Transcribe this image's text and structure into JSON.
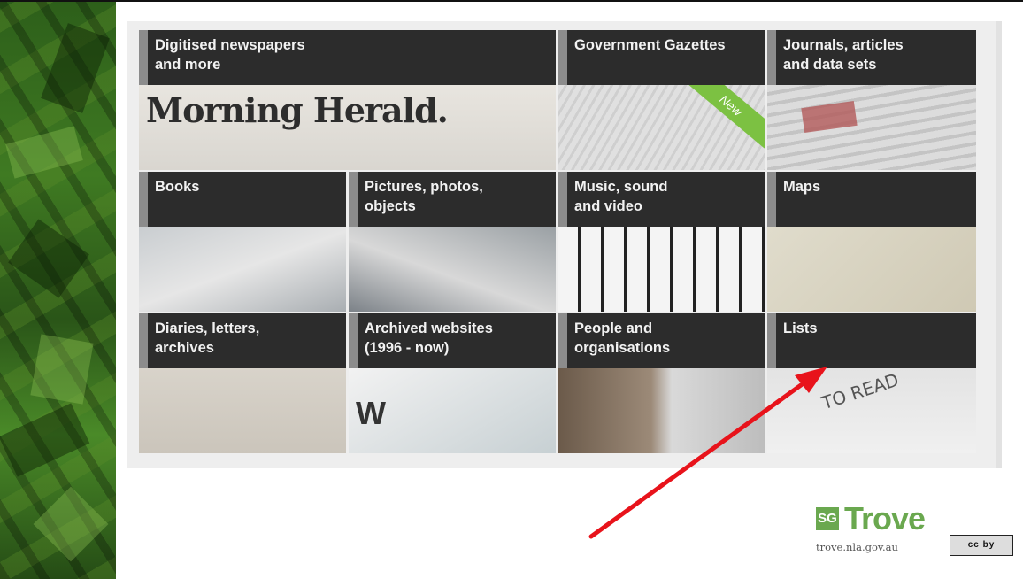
{
  "tiles": [
    {
      "id": "newspapers",
      "line1": "Digitised newspapers",
      "line2": "and more"
    },
    {
      "id": "gazettes",
      "line1": "Government Gazettes",
      "line2": ""
    },
    {
      "id": "journals",
      "line1": "Journals, articles",
      "line2": "and data sets"
    },
    {
      "id": "books",
      "line1": "Books",
      "line2": ""
    },
    {
      "id": "pictures",
      "line1": "Pictures, photos,",
      "line2": "objects"
    },
    {
      "id": "music",
      "line1": "Music, sound",
      "line2": "and video"
    },
    {
      "id": "maps",
      "line1": "Maps",
      "line2": ""
    },
    {
      "id": "diaries",
      "line1": "Diaries, letters,",
      "line2": "archives"
    },
    {
      "id": "websites",
      "line1": "Archived websites",
      "line2": "(1996 - now)"
    },
    {
      "id": "people",
      "line1": "People and",
      "line2": "organisations"
    },
    {
      "id": "lists",
      "line1": "Lists",
      "line2": ""
    }
  ],
  "image_text": {
    "morning_herald": "Morning Herald.",
    "new_ribbon": "New",
    "to_read": "TO READ",
    "w_key": "W"
  },
  "logo": {
    "mark": "SG",
    "wordmark": "Trove",
    "url": "trove.nla.gov.au"
  },
  "license_badge": "cc by",
  "colors": {
    "tile_header_bg": "#2c2c2c",
    "tile_header_border": "#8c8c8c",
    "trove_green": "#6aa84f",
    "new_ribbon": "#7cc142",
    "arrow": "#e8131b",
    "side_band": "#3f7a22"
  }
}
